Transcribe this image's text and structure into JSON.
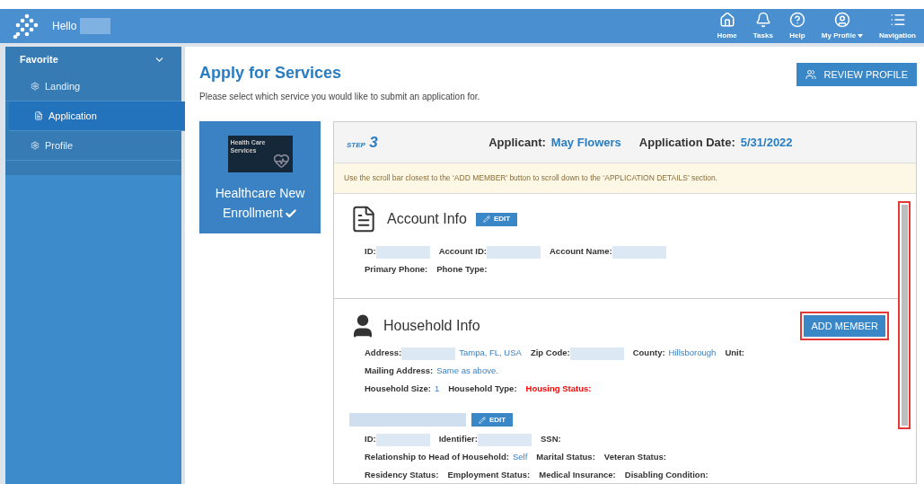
{
  "header": {
    "greeting": "Hello",
    "nav": [
      {
        "kind": "home",
        "label": "Home"
      },
      {
        "kind": "tasks",
        "label": "Tasks"
      },
      {
        "kind": "help",
        "label": "Help"
      },
      {
        "kind": "profile",
        "label": "My Profile",
        "dropdown": true
      },
      {
        "kind": "menu",
        "label": "Navigation",
        "dropdown": false
      }
    ]
  },
  "sidebar": {
    "group": "Favorite",
    "expanded": true,
    "items": [
      {
        "kind": "gear",
        "label": "Landing",
        "selected": false
      },
      {
        "kind": "doc",
        "label": "Application",
        "selected": true
      },
      {
        "kind": "gear",
        "label": "Profile",
        "selected": false
      }
    ]
  },
  "page": {
    "title": "Apply for Services",
    "subtitle": "Please select which service you would like to submit an application for.",
    "review_button": "REVIEW PROFILE"
  },
  "service_card": {
    "image_text": "Health Care Services",
    "label": "Healthcare New Enrollment",
    "checked": true
  },
  "application": {
    "step_label": "STEP",
    "step_number": "3",
    "applicant_label": "Applicant:",
    "applicant": "May Flowers",
    "date_label": "Application Date:",
    "date": "5/31/2022",
    "notice": "Use the scroll bar closest to the ‘ADD MEMBER’ button to scroll down to the ‘APPLICATION DETAILS’ section.",
    "scrollbar_highlighted": true
  },
  "account": {
    "title": "Account Info",
    "edit": "EDIT",
    "lines": [
      {
        "fields": [
          {
            "kind": "redacted",
            "label": "ID:"
          },
          {
            "kind": "redacted",
            "label": "Account ID:"
          },
          {
            "kind": "redacted",
            "label": "Account Name:"
          }
        ]
      },
      {
        "fields": [
          {
            "kind": "plain",
            "label": "Primary Phone:"
          },
          {
            "kind": "plain",
            "label": "Phone Type:"
          }
        ]
      }
    ]
  },
  "household": {
    "title": "Household Info",
    "add_member": "ADD MEMBER",
    "add_member_highlighted": true,
    "lines": [
      {
        "fields": [
          {
            "kind": "redacted",
            "label": "Address:",
            "value": "Tampa, FL, USA"
          },
          {
            "kind": "redacted",
            "label": "Zip Code:"
          },
          {
            "kind": "plain",
            "label": "County:",
            "value": "Hillsborough"
          },
          {
            "kind": "plain",
            "label": "Unit:"
          }
        ]
      },
      {
        "fields": [
          {
            "kind": "plain",
            "label": "Mailing Address:",
            "value": "Same as above."
          }
        ]
      },
      {
        "fields": [
          {
            "kind": "plain",
            "label": "Household Size:",
            "value": "1"
          },
          {
            "kind": "plain",
            "label": "Household Type:"
          },
          {
            "kind": "alert",
            "label": "Housing Status:"
          }
        ]
      }
    ]
  },
  "member": {
    "edit": "EDIT",
    "lines": [
      {
        "fields": [
          {
            "kind": "redacted",
            "label": "ID:"
          },
          {
            "kind": "redacted",
            "label": "Identifier:"
          },
          {
            "kind": "plain",
            "label": "SSN:"
          }
        ]
      },
      {
        "fields": [
          {
            "kind": "plain",
            "label": "Relationship to Head of Household:",
            "value": "Self"
          },
          {
            "kind": "plain",
            "label": "Marital Status:"
          },
          {
            "kind": "plain",
            "label": "Veteran Status:"
          }
        ]
      },
      {
        "fields": [
          {
            "kind": "plain",
            "label": "Residency Status:"
          },
          {
            "kind": "plain",
            "label": "Employment Status:"
          },
          {
            "kind": "plain",
            "label": "Medical Insurance:"
          },
          {
            "kind": "plain",
            "label": "Disabling Condition:"
          }
        ]
      }
    ]
  }
}
